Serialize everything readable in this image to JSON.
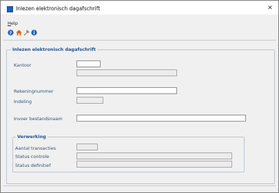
{
  "window": {
    "title": "Inlezen elektronisch dagafschrift",
    "close_glyph": "✕"
  },
  "menu": {
    "items": [
      {
        "label_underlined": "H",
        "label_rest": "elp"
      }
    ]
  },
  "toolbar": {
    "icons": [
      "help-icon",
      "home-icon",
      "tools-icon",
      "info-icon"
    ]
  },
  "main_group": {
    "legend": "Inlezen elektronisch dagafschrift",
    "fields": {
      "kantoor_label": "Kantoor",
      "kantoor_value": "",
      "kantoor_name_value": "",
      "rekeningnummer_label": "Rekeningnummer",
      "rekeningnummer_value": "",
      "indeling_label": "Indeling",
      "indeling_value": "",
      "invoer_label": "Invoer bestandsnaam",
      "invoer_value": ""
    }
  },
  "verwerking_group": {
    "legend": "Verwerking",
    "fields": {
      "aantal_label": "Aantal transacties",
      "aantal_value": "",
      "status_controle_label": "Status controle",
      "status_controle_value": "",
      "status_definitief_label": "Status definitief",
      "status_definitief_value": ""
    }
  },
  "colors": {
    "label": "#2f4f7a",
    "legend": "#1e4d8c",
    "window_bg": "#f0f0f0"
  }
}
